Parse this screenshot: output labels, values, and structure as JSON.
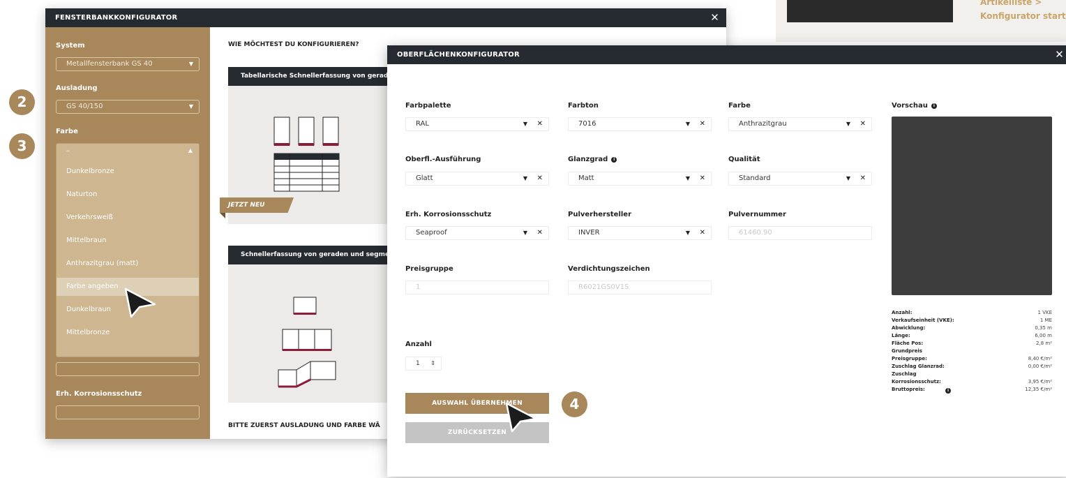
{
  "background": {
    "link_1": "Artikelliste >",
    "link_2": "Konfigurator starten"
  },
  "fenster": {
    "title": "FENSTERBANKKONFIGURATOR",
    "close": "✕",
    "sidebar": {
      "system_label": "System",
      "system_value": "Metallfensterbank GS 40",
      "ausladung_label": "Ausladung",
      "ausladung_value": "GS 40/150",
      "farbe_label": "Farbe",
      "farbe_value": "–",
      "farbe_options": [
        "Dunkelbronze",
        "Naturton",
        "Verkehrsweiß",
        "Mittelbraun",
        "Anthrazitgrau (matt)",
        "Farbe angeben",
        "Dunkelbraun",
        "Mittelbronze"
      ],
      "highlighted_option": "Farbe angeben",
      "korrosion_label": "Erh. Korrosionsschutz"
    },
    "content": {
      "heading": "WIE MÖCHTEST DU KONFIGURIEREN?",
      "card1_title": "Tabellarische Schnellerfassung von geraden",
      "card1_badge": "JETZT NEU",
      "card2_title": "Schnellerfassung von geraden und segmen",
      "footer_note": "BITTE ZUERST AUSLADUNG UND FARBE WÄ"
    }
  },
  "oberflaeche": {
    "title": "OBERFLÄCHENKONFIGURATOR",
    "close": "✕",
    "fields": {
      "farbpalette": {
        "label": "Farbpalette",
        "value": "RAL"
      },
      "farbton": {
        "label": "Farbton",
        "value": "7016"
      },
      "farbe": {
        "label": "Farbe",
        "value": "Anthrazitgrau"
      },
      "ausfuehrung": {
        "label": "Oberfl.-Ausführung",
        "value": "Glatt"
      },
      "glanzgrad": {
        "label": "Glanzgrad",
        "value": "Matt"
      },
      "qualitaet": {
        "label": "Qualität",
        "value": "Standard"
      },
      "korrosion": {
        "label": "Erh. Korrosionsschutz",
        "value": "Seaproof"
      },
      "pulverhersteller": {
        "label": "Pulverhersteller",
        "value": "INVER"
      },
      "pulvernummer": {
        "label": "Pulvernummer",
        "value": "61460.90"
      },
      "preisgruppe": {
        "label": "Preisgruppe",
        "value": "1"
      },
      "verdichtung": {
        "label": "Verdichtungszeichen",
        "value": "R6021GS0V1S"
      },
      "anzahl": {
        "label": "Anzahl",
        "value": "1"
      }
    },
    "preview_label": "Vorschau",
    "preview_color": "#3d3d3d",
    "stats": [
      {
        "key": "Anzahl:",
        "value": "1 VKE"
      },
      {
        "key": "Verkaufseinheit (VKE):",
        "value": "1 ME"
      },
      {
        "key": "Abwicklung:",
        "value": "0,35 m"
      },
      {
        "key": "Länge:",
        "value": "6,00 m"
      },
      {
        "key": "Fläche Pos:",
        "value": "2,8 m²"
      },
      {
        "key": "Grundpreis",
        "value": ""
      },
      {
        "key": "Preisgruppe:",
        "value": "8,40 €/m²"
      },
      {
        "key": "Zuschlag Glanzrad:",
        "value": "0,00 €/m²"
      },
      {
        "key": "Zuschlag",
        "value": ""
      },
      {
        "key": "Korrosionsschutz:",
        "value": "3,95 €/m²"
      },
      {
        "key": "Bruttopreis:",
        "value": "12,35 €/m²"
      }
    ],
    "btn_apply": "AUSWAHL ÜBERNEHMEN",
    "btn_reset": "ZURÜCKSETZEN"
  },
  "steps": [
    "2",
    "3",
    "4"
  ],
  "accent_color": "#a8875a",
  "header_color": "#262b31"
}
